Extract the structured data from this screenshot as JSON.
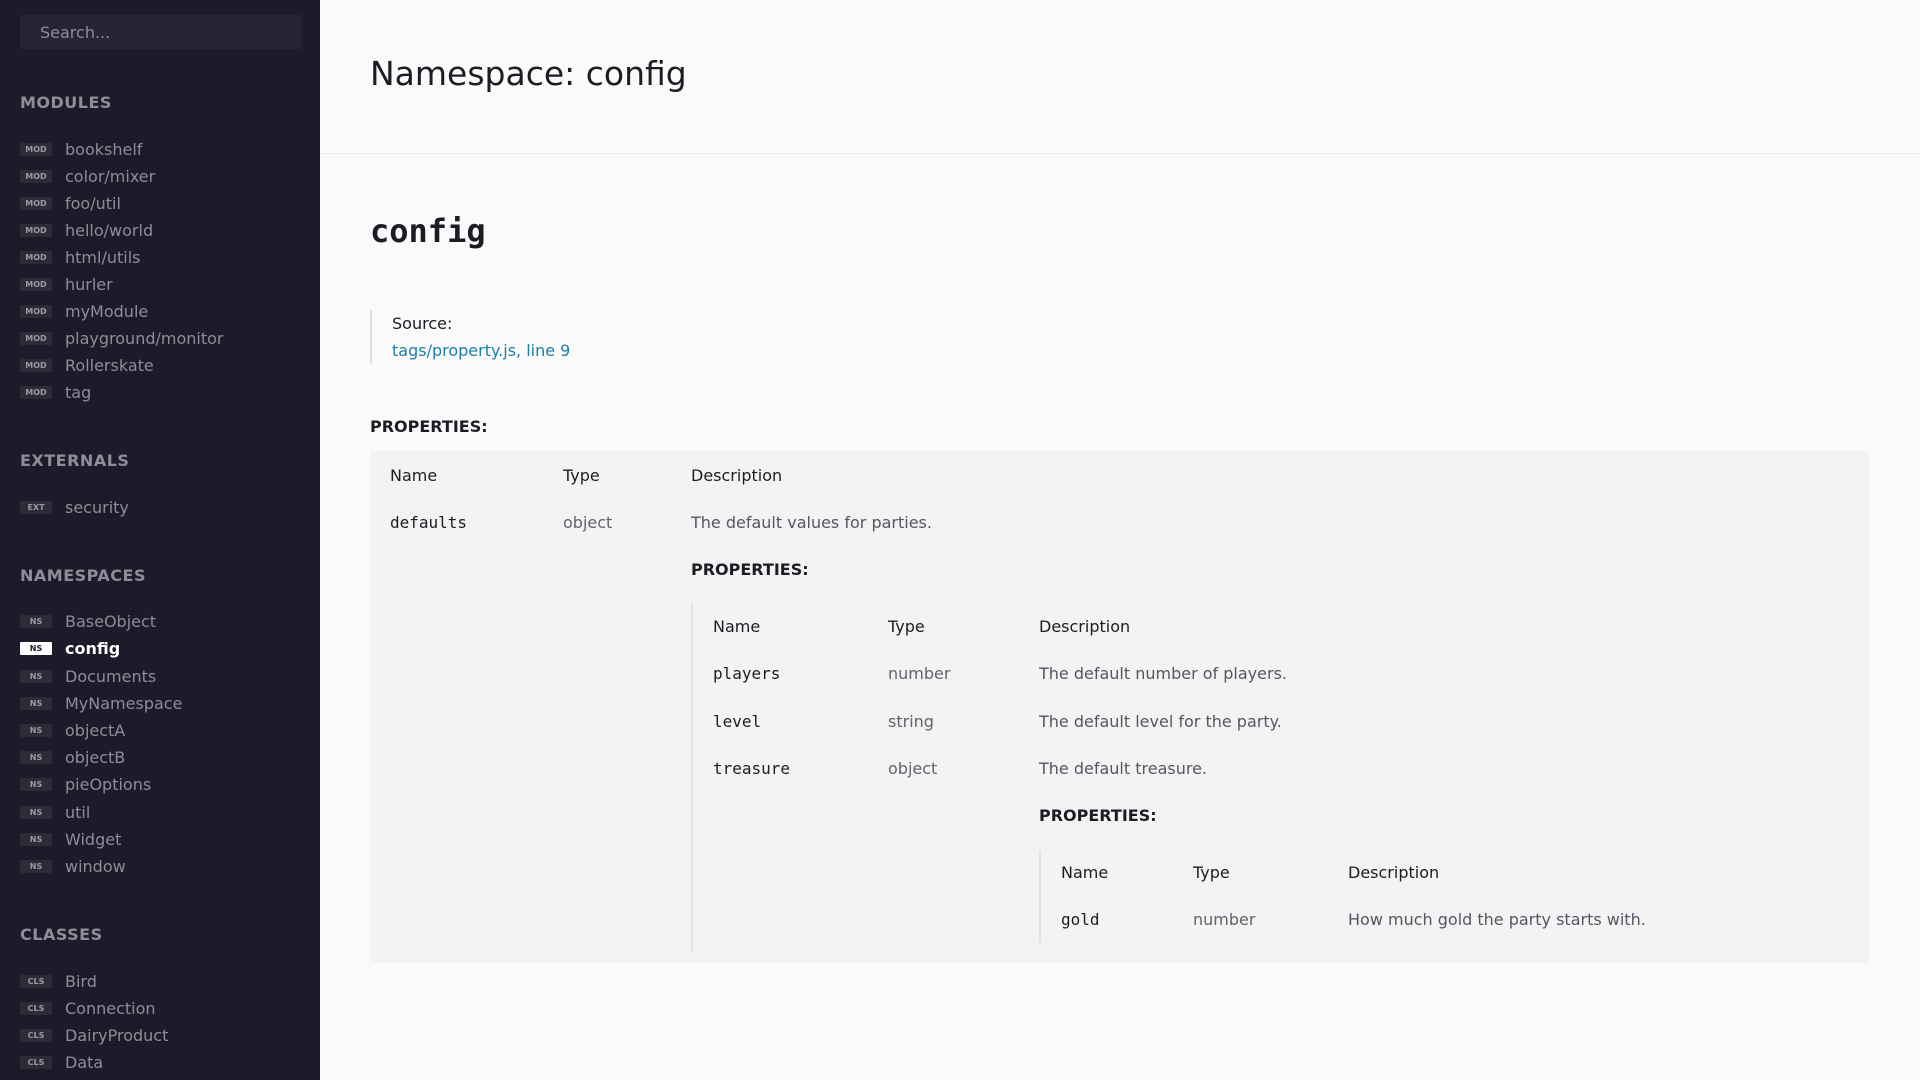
{
  "sidebar": {
    "search_placeholder": "Search...",
    "sections": [
      {
        "title": "MODULES",
        "badge": "MOD",
        "items": [
          "bookshelf",
          "color/mixer",
          "foo/util",
          "hello/world",
          "html/utils",
          "hurler",
          "myModule",
          "playground/monitor",
          "Rollerskate",
          "tag"
        ]
      },
      {
        "title": "EXTERNALS",
        "badge": "EXT",
        "items": [
          "security"
        ]
      },
      {
        "title": "NAMESPACES",
        "badge": "NS",
        "items": [
          "BaseObject",
          "config",
          "Documents",
          "MyNamespace",
          "objectA",
          "objectB",
          "pieOptions",
          "util",
          "Widget",
          "window"
        ],
        "active": "config"
      },
      {
        "title": "CLASSES",
        "badge": "CLS",
        "items": [
          "Bird",
          "Connection",
          "DairyProduct",
          "Data"
        ]
      }
    ]
  },
  "main": {
    "page_title": "Namespace: config",
    "namespace_name": "config",
    "source_label": "Source:",
    "source_link": "tags/property.js, line 9",
    "properties_heading": "PROPERTIES:",
    "columns": {
      "name": "Name",
      "type": "Type",
      "description": "Description"
    },
    "properties": [
      {
        "name": "defaults",
        "type": "object",
        "description": "The default values for parties.",
        "properties": [
          {
            "name": "players",
            "type": "number",
            "description": "The default number of players."
          },
          {
            "name": "level",
            "type": "string",
            "description": "The default level for the party."
          },
          {
            "name": "treasure",
            "type": "object",
            "description": "The default treasure.",
            "properties": [
              {
                "name": "gold",
                "type": "number",
                "description": "How much gold the party starts with."
              }
            ]
          }
        ]
      }
    ]
  },
  "colors": {
    "sidebar_bg": "#1c1b29",
    "link": "#1d7ea8",
    "page_bg": "#fafafa"
  }
}
